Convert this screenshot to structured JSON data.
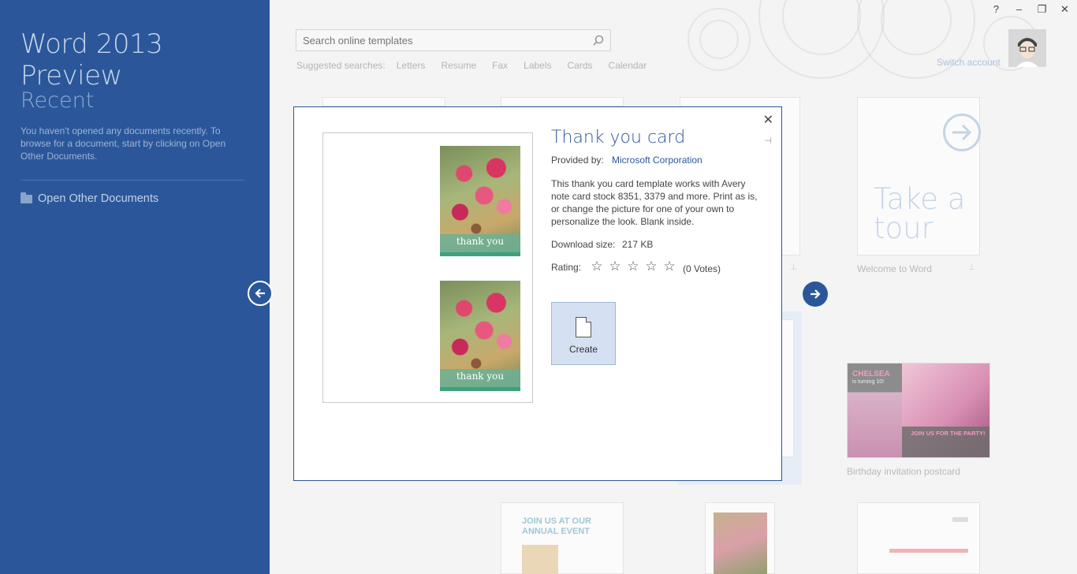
{
  "left": {
    "app_title": "Word 2013 Preview",
    "recent_heading": "Recent",
    "recent_message": "You haven't opened any documents recently. To browse for a document, start by clicking on Open Other Documents.",
    "open_other": "Open Other Documents"
  },
  "search": {
    "placeholder": "Search online templates",
    "suggested_label": "Suggested searches:",
    "suggestions": [
      "Letters",
      "Resume",
      "Fax",
      "Labels",
      "Cards",
      "Calendar"
    ]
  },
  "window_controls": {
    "help": "?",
    "minimize": "–",
    "restore": "❐",
    "close": "✕"
  },
  "account": {
    "switch_label": "Switch account"
  },
  "tiles": {
    "take_a_tour_line1": "Take a",
    "take_a_tour_line2": "tour",
    "welcome_label": "Welcome to Word",
    "birthday_label": "Birthday invitation postcard",
    "birthday_name": "CHELSEA",
    "birthday_sub": "is turning 10!",
    "birthday_join": "JOIN US FOR THE PARTY!",
    "event_line1": "JOIN US AT OUR",
    "event_line2": "ANNUAL EVENT"
  },
  "modal": {
    "title": "Thank you card",
    "provided_label": "Provided by:",
    "provider": "Microsoft Corporation",
    "description": "This thank you card template works with Avery note card stock 8351, 3379 and more. Print as is, or change the picture for one of your own to personalize the look. Blank inside.",
    "download_label": "Download size:",
    "download_value": "217 KB",
    "rating_label": "Rating:",
    "votes": "(0 Votes)",
    "stars": [
      "☆",
      "☆",
      "☆",
      "☆",
      "☆"
    ],
    "card_text": "thank you",
    "create_label": "Create",
    "close": "✕",
    "pin": "⊣"
  },
  "colors": {
    "brand": "#2b579a",
    "link": "#2b579a"
  }
}
